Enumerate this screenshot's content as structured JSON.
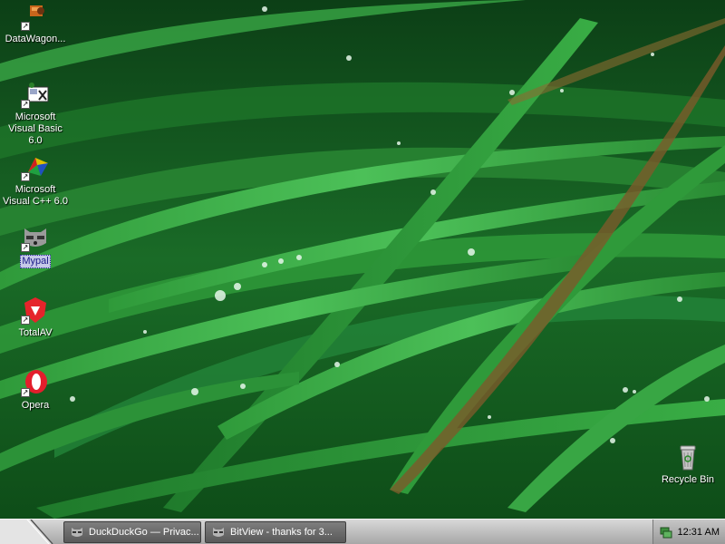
{
  "desktop": {
    "icons": [
      {
        "label": "DataWagon..."
      },
      {
        "label": "Microsoft Visual Basic 6.0"
      },
      {
        "label": "Microsoft Visual C++ 6.0"
      },
      {
        "label": "Mypal"
      },
      {
        "label": "TotalAV"
      },
      {
        "label": "Opera"
      },
      {
        "label": "Recycle Bin"
      }
    ],
    "selected_icon": "Mypal"
  },
  "taskbar": {
    "tasks": [
      {
        "label": "DuckDuckGo — Privac..."
      },
      {
        "label": "BitView - thanks for 3..."
      }
    ],
    "clock": "12:31 AM"
  }
}
